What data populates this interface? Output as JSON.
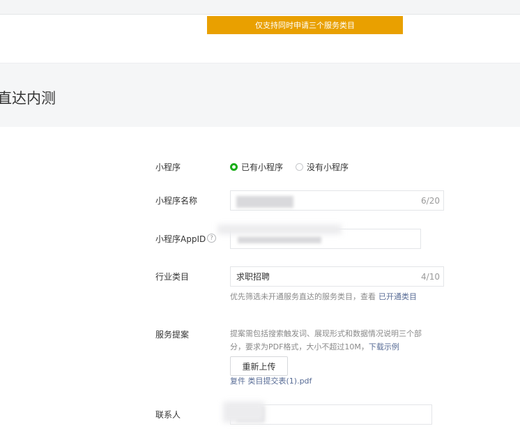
{
  "banner": {
    "text": "仅支持同时申请三个服务类目"
  },
  "section": {
    "title": "直达内测"
  },
  "form": {
    "mini_program": {
      "label": "小程序",
      "options": [
        {
          "label": "已有小程序",
          "checked": true
        },
        {
          "label": "没有小程序",
          "checked": false
        }
      ]
    },
    "name": {
      "label": "小程序名称",
      "counter": "6/20"
    },
    "appid": {
      "label": "小程序AppID",
      "help_icon": "?"
    },
    "industry": {
      "label": "行业类目",
      "value": "求职招聘",
      "counter": "4/10",
      "hint": "优先筛选未开通服务直达的服务类目，查看",
      "hint_link": "已开通类目"
    },
    "proposal": {
      "label": "服务提案",
      "hint_line1": "提案需包括搜索触发词、展现形式和数据情况说明三个部",
      "hint_line2": "分，要求为PDF格式，大小不超过10M，",
      "hint_link": "下载示例",
      "reupload_button": "重新上传",
      "file_prefix": "复件",
      "file_name": "类目提交表(1).pdf"
    },
    "contact": {
      "label": "联系人"
    }
  },
  "colors": {
    "accent": "#1aad19",
    "banner": "#e9a000",
    "link": "#576b95"
  }
}
